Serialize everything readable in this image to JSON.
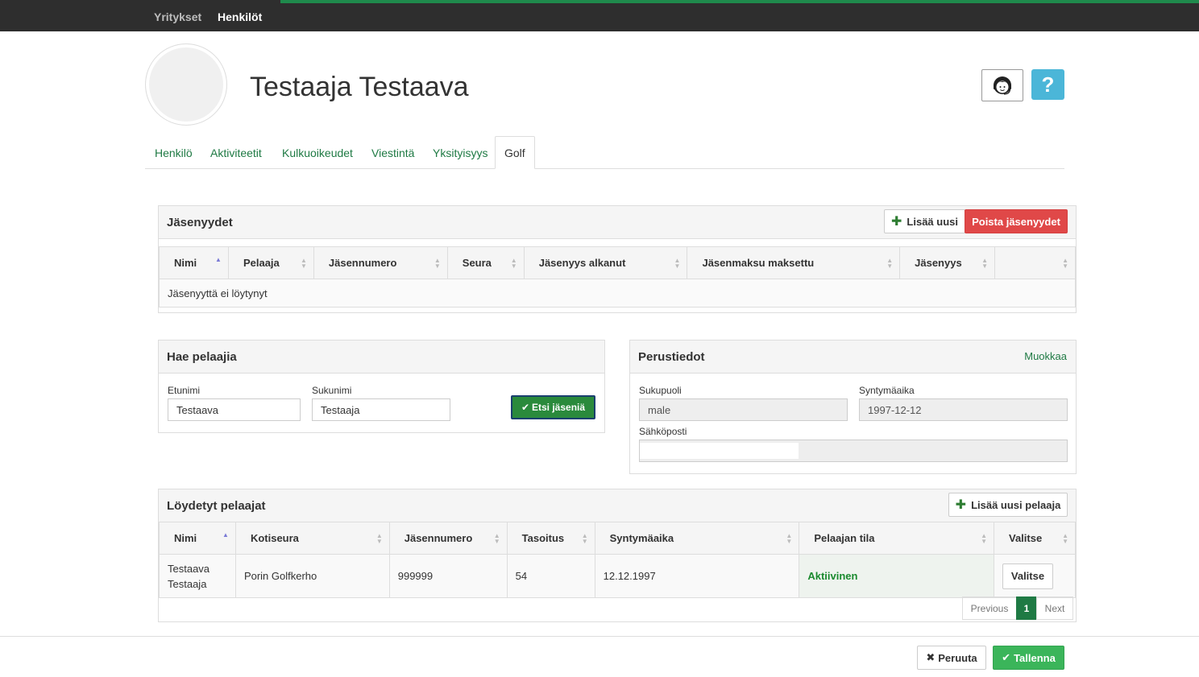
{
  "topnav": {
    "companies": "Yritykset",
    "people": "Henkilöt"
  },
  "person": {
    "name": "Testaaja Testaava"
  },
  "tabs": [
    "Henkilö",
    "Aktiviteetit",
    "Kulkuoikeudet",
    "Viestintä",
    "Yksityisyys",
    "Golf"
  ],
  "help_label": "?",
  "memberships": {
    "title": "Jäsenyydet",
    "add_label": "Lisää uusi",
    "delete_label": "Poista jäsenyydet",
    "columns": [
      "Nimi",
      "Pelaaja",
      "Jäsennumero",
      "Seura",
      "Jäsenyys alkanut",
      "Jäsenmaksu maksettu",
      "Jäsenyys",
      ""
    ],
    "empty_text": "Jäsenyyttä ei löytynyt"
  },
  "search": {
    "title": "Hae pelaajia",
    "first_name_label": "Etunimi",
    "first_name_value": "Testaava",
    "last_name_label": "Sukunimi",
    "last_name_value": "Testaaja",
    "search_button": "Etsi jäseniä"
  },
  "basic_info": {
    "title": "Perustiedot",
    "edit_label": "Muokkaa",
    "gender_label": "Sukupuoli",
    "gender_value": "male",
    "birthdate_label": "Syntymäaika",
    "birthdate_value": "1997-12-12",
    "email_label": "Sähköposti"
  },
  "found_players": {
    "title": "Löydetyt pelaajat",
    "add_player_label": "Lisää uusi pelaaja",
    "columns": [
      "Nimi",
      "Kotiseura",
      "Jäsennumero",
      "Tasoitus",
      "Syntymäaika",
      "Pelaajan tila",
      "Valitse"
    ],
    "rows": [
      {
        "name": "Testaava Testaaja",
        "club": "Porin Golfkerho",
        "member_number": "999999",
        "handicap": "54",
        "birthdate": "12.12.1997",
        "status": "Aktiivinen",
        "select_label": "Valitse"
      }
    ],
    "pager": {
      "previous": "Previous",
      "page": "1",
      "next": "Next"
    }
  },
  "footer": {
    "cancel_label": "Peruuta",
    "save_label": "Tallenna"
  },
  "colors": {
    "accent": "#1f8a4c",
    "danger": "#e04848",
    "info": "#4bb6d8",
    "active_status": "#1a8a2e"
  }
}
